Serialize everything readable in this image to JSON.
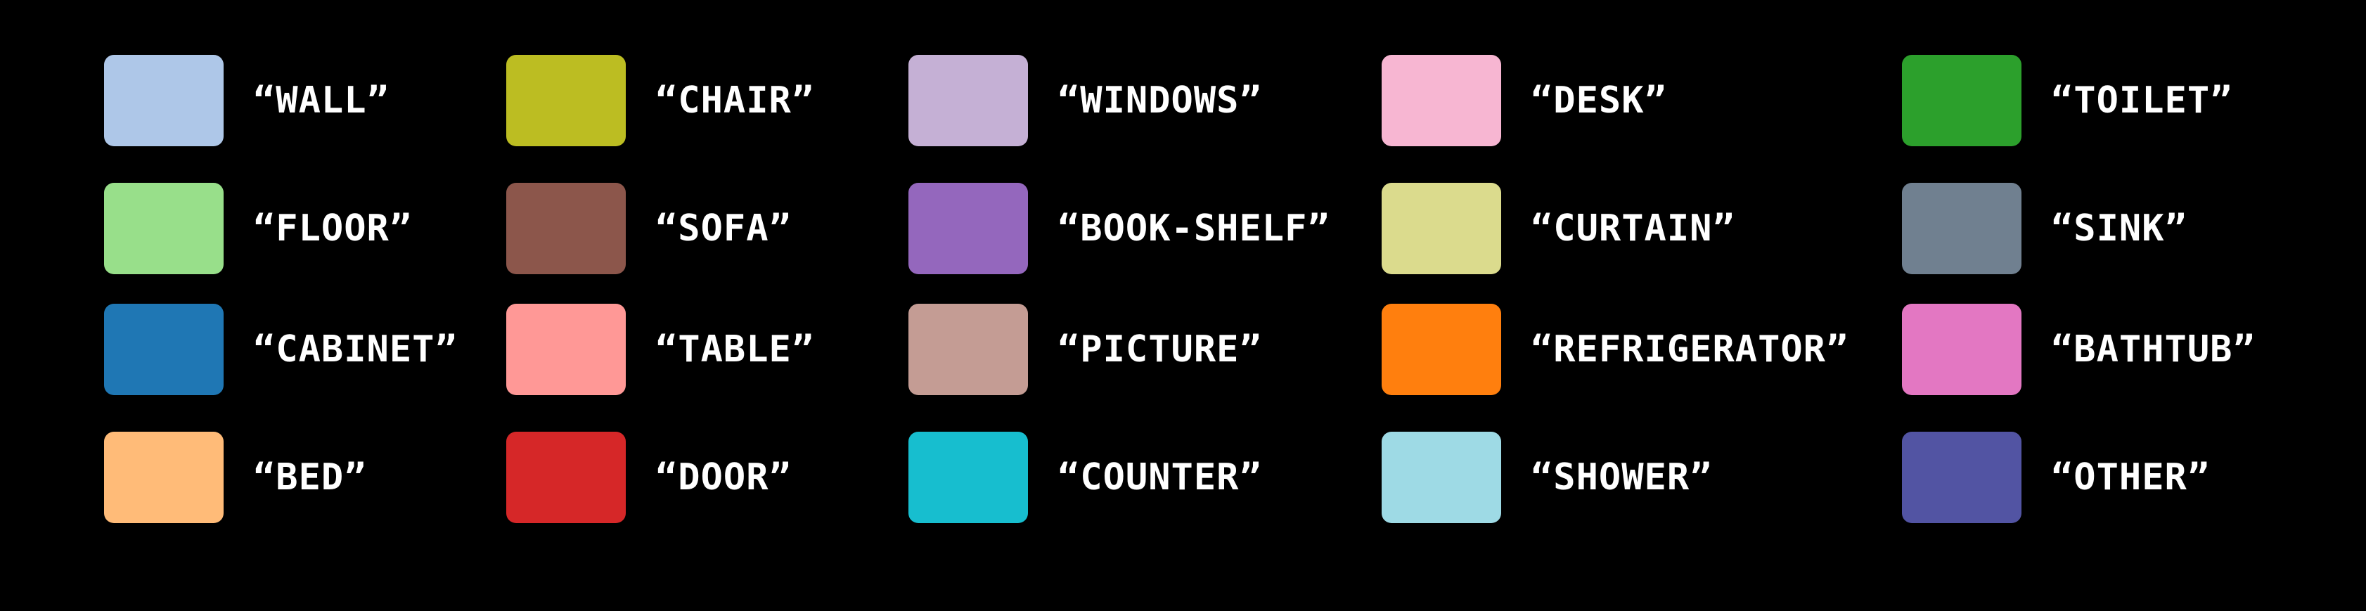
{
  "legend": {
    "items": [
      {
        "label": "“WALL”",
        "color": "#AEC7E8"
      },
      {
        "label": "“FLOOR”",
        "color": "#98DF8A"
      },
      {
        "label": "“CABINET”",
        "color": "#1F77B4"
      },
      {
        "label": "“BED”",
        "color": "#FFBB78"
      },
      {
        "label": "“CHAIR”",
        "color": "#BCBD22"
      },
      {
        "label": "“SOFA”",
        "color": "#8C564B"
      },
      {
        "label": "“TABLE”",
        "color": "#FF9896"
      },
      {
        "label": "“DOOR”",
        "color": "#D62728"
      },
      {
        "label": "“WINDOWS”",
        "color": "#C5B0D5"
      },
      {
        "label": "“BOOK-SHELF”",
        "color": "#9467BD"
      },
      {
        "label": "“PICTURE”",
        "color": "#C49C94"
      },
      {
        "label": "“COUNTER”",
        "color": "#17BECF"
      },
      {
        "label": "“DESK”",
        "color": "#F7B6D2"
      },
      {
        "label": "“CURTAIN”",
        "color": "#DBDB8D"
      },
      {
        "label": "“REFRIGERATOR”",
        "color": "#FF7F0E"
      },
      {
        "label": "“SHOWER”",
        "color": "#9EDAE5"
      },
      {
        "label": "“TOILET”",
        "color": "#2CA02C"
      },
      {
        "label": "“SINK”",
        "color": "#708090"
      },
      {
        "label": "“BATHTUB”",
        "color": "#E377C2"
      },
      {
        "label": "“OTHER”",
        "color": "#5254A3"
      }
    ]
  }
}
